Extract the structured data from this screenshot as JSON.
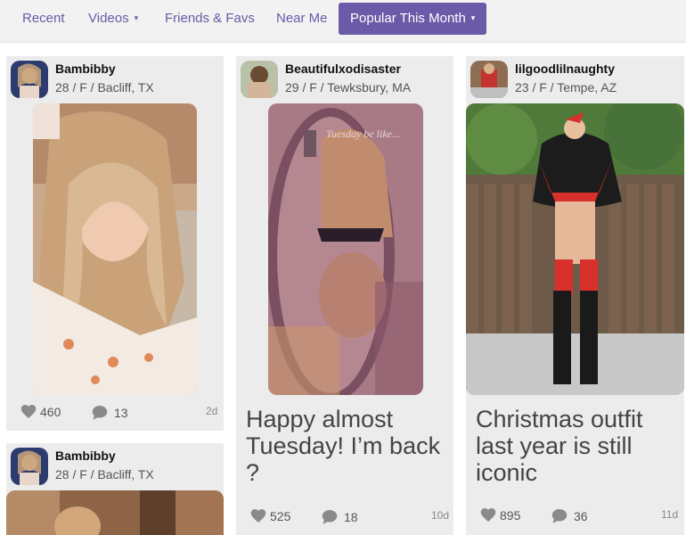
{
  "nav": {
    "recent": "Recent",
    "videos": "Videos",
    "friends": "Friends & Favs",
    "near": "Near Me",
    "popular": "Popular This Month"
  },
  "colors": {
    "accent": "#6b5aa8",
    "card_bg": "#ececec",
    "icon_gray": "#8a8a8a"
  },
  "icons": {
    "caret": "▾",
    "like": "heart-icon",
    "comment": "comment-icon"
  },
  "posts": [
    {
      "username": "Bambibby",
      "meta": "28 / F / Bacliff, TX",
      "likes": "460",
      "comments": "13",
      "age": "2d",
      "text": ""
    },
    {
      "username": "Beautifulxodisaster",
      "meta": "29 / F / Tewksbury, MA",
      "likes": "525",
      "comments": "18",
      "age": "10d",
      "text": "Happy almost Tuesday! I’m back ?",
      "image_caption": "Tuesday be like..."
    },
    {
      "username": "lilgoodlilnaughty",
      "meta": "23 / F / Tempe, AZ",
      "likes": "895",
      "comments": "36",
      "age": "11d",
      "text": "Christmas outfit last year is still iconic"
    },
    {
      "username": "Bambibby",
      "meta": "28 / F / Bacliff, TX",
      "likes": "",
      "comments": "",
      "age": "",
      "text": ""
    }
  ]
}
